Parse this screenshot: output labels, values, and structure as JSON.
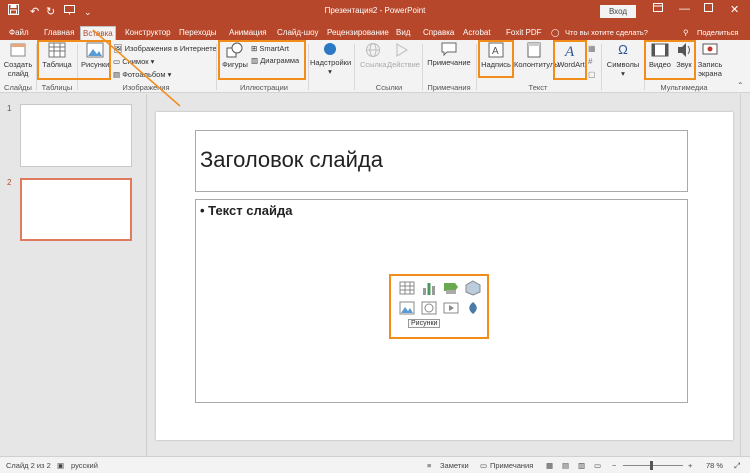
{
  "titlebar": {
    "document_title": "Презентация2 - PowerPoint",
    "signin_label": "Вход"
  },
  "tabs": [
    {
      "label": "Файл"
    },
    {
      "label": "Главная"
    },
    {
      "label": "Вставка"
    },
    {
      "label": "Конструктор"
    },
    {
      "label": "Переходы"
    },
    {
      "label": "Анимация"
    },
    {
      "label": "Слайд-шоу"
    },
    {
      "label": "Рецензирование"
    },
    {
      "label": "Вид"
    },
    {
      "label": "Справка"
    },
    {
      "label": "Acrobat"
    },
    {
      "label": "Foxit PDF"
    }
  ],
  "tell_me": "Что вы хотите сделать?",
  "share": "Поделиться",
  "ribbon": {
    "slides": {
      "new_slide": "Создать слайд",
      "group": "Слайды"
    },
    "tables": {
      "table": "Таблица",
      "group": "Таблицы"
    },
    "images": {
      "pictures": "Рисунки",
      "online": "Изображения в Интернете",
      "screenshot": "Снимок",
      "album": "Фотоальбом",
      "group": "Изображения"
    },
    "illustrations": {
      "shapes": "Фигуры",
      "smartart": "SmartArt",
      "chart": "Диаграмма",
      "group": "Иллюстрации"
    },
    "addins": {
      "label": "Надстройки"
    },
    "links": {
      "link": "Ссылка",
      "action": "Действие",
      "group": "Ссылки"
    },
    "comments": {
      "comment": "Примечание",
      "group": "Примечания"
    },
    "text": {
      "textbox": "Надпись",
      "header_footer": "Колонтитулы",
      "wordart": "WordArt",
      "group": "Текст"
    },
    "symbols": {
      "label": "Символы"
    },
    "media": {
      "video": "Видео",
      "audio": "Звук",
      "record": "Запись экрана",
      "group": "Мультимедиа"
    }
  },
  "thumbnails": [
    {
      "number": "1"
    },
    {
      "number": "2"
    }
  ],
  "slide": {
    "title_placeholder": "Заголовок слайда",
    "body_placeholder": "• Текст слайда",
    "tooltip": "Рисунки"
  },
  "status": {
    "slide_info": "Слайд 2 из 2",
    "language": "русский",
    "notes": "Заметки",
    "comments": "Примечания",
    "zoom": "78 %"
  },
  "colors": {
    "accent": "#b7472a",
    "highlight": "#f28d1c"
  },
  "icons": [
    "save-icon",
    "undo-icon",
    "redo-icon",
    "present-icon",
    "customize-icon",
    "minimize-icon",
    "maximize-icon",
    "close-icon",
    "lightbulb-icon",
    "person-icon",
    "new-slide-icon",
    "table-icon",
    "pictures-icon",
    "online-pictures-icon",
    "screenshot-icon",
    "album-icon",
    "shapes-icon",
    "smartart-icon",
    "chart-icon",
    "addins-icon",
    "link-icon",
    "action-icon",
    "comment-icon",
    "textbox-icon",
    "header-footer-icon",
    "wordart-icon",
    "symbols-icon",
    "video-icon",
    "audio-icon",
    "record-icon"
  ]
}
